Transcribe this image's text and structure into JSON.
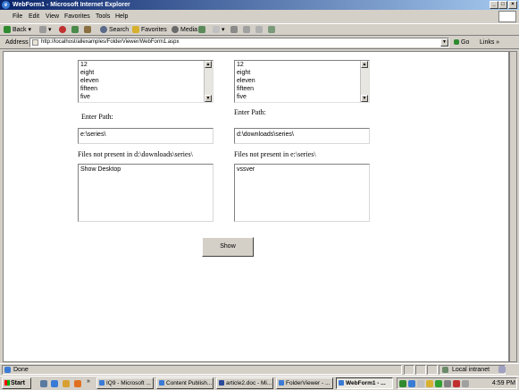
{
  "window": {
    "title": "WebForm1 - Microsoft Internet Explorer"
  },
  "menu": [
    "File",
    "Edit",
    "View",
    "Favorites",
    "Tools",
    "Help"
  ],
  "toolbar": {
    "back": "Back",
    "search": "Search",
    "favorites": "Favorites",
    "media": "Media"
  },
  "address": {
    "label": "Address",
    "url": "http://localhost/allexamples/FolderViewer/WebForm1.aspx",
    "go": "Go",
    "links": "Links"
  },
  "left": {
    "list_items": [
      "12",
      "eight",
      "eleven",
      "fifteen",
      "five"
    ],
    "path_label": "Enter Path:",
    "path_value": "e:\\series\\",
    "files_label": "Files not present in d:\\downloads\\series\\",
    "files": [
      "Show Desktop"
    ]
  },
  "right": {
    "list_items": [
      "12",
      "eight",
      "eleven",
      "fifteen",
      "five"
    ],
    "path_label": "Enter Path:",
    "path_value": "d:\\downloads\\series\\",
    "files_label": "Files not present in e:\\series\\",
    "files": [
      "vssver"
    ]
  },
  "show_button": "Show",
  "status": {
    "text": "Done",
    "zone": "Local intranet"
  },
  "taskbar": {
    "start": "Start",
    "tasks": [
      "IQ9 - Microsoft ...",
      "Content Publish...",
      "article2.doc - Mi...",
      "FolderViewer - ...",
      "WebForm1 - ..."
    ],
    "clock": "4:59 PM"
  }
}
